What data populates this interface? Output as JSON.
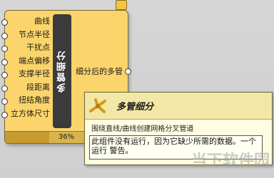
{
  "component": {
    "nickname": "多管细分",
    "inputs": [
      {
        "label": "曲线"
      },
      {
        "label": "节点半径"
      },
      {
        "label": "干扰点"
      },
      {
        "label": "端点偏移"
      },
      {
        "label": "支撑半径"
      },
      {
        "label": "段距离"
      },
      {
        "label": "扭结角度"
      },
      {
        "label": "立方体尺寸"
      }
    ],
    "output_label": "细分后的多管",
    "progress_text": "36%",
    "progress_fraction": 0.36
  },
  "tooltip": {
    "title": "多管细分",
    "subtitle": "围绕直线/曲线创建网格分叉管道",
    "warning": "此组件没有运行，因为它缺少所需的数据。一个  运行  警告。"
  },
  "watermark": "当下软件园"
}
